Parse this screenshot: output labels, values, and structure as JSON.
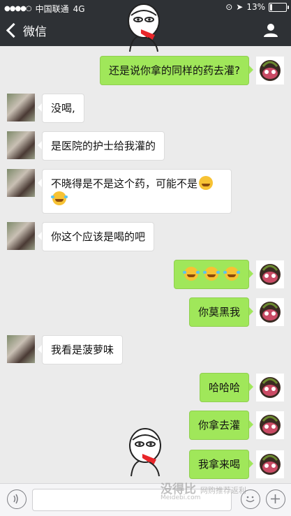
{
  "status_bar": {
    "carrier": "中国联通",
    "network": "4G",
    "battery": "13%",
    "battery_level": 0.13
  },
  "nav": {
    "back_label": "微信",
    "back_icon": "chevron-left-icon",
    "profile_icon": "person-icon"
  },
  "messages": [
    {
      "from": "me",
      "text": "还是说你拿的同样的药去灌?"
    },
    {
      "from": "other",
      "text": "没喝,"
    },
    {
      "from": "other",
      "text": "是医院的护士给我灌的"
    },
    {
      "from": "other",
      "text": "不晓得是不是这个药，可能不是"
    },
    {
      "from": "other",
      "text": "你这个应该是喝的吧"
    },
    {
      "from": "me",
      "emojis": [
        "tears-of-joy",
        "tears-of-joy",
        "tears-of-joy"
      ]
    },
    {
      "from": "me",
      "text": "你莫黑我"
    },
    {
      "from": "other",
      "text": "我看是菠萝味"
    },
    {
      "from": "me",
      "text": "哈哈哈"
    },
    {
      "from": "me",
      "text": "你拿去灌"
    },
    {
      "from": "me",
      "text": "我拿来喝"
    }
  ],
  "input_bar": {
    "voice_icon": "voice-icon",
    "emoji_icon": "emoji-icon",
    "add_icon": "plus-icon"
  },
  "watermark": {
    "title": "没得比",
    "subtitle": "Meidebi.com",
    "tagline": "网购推荐返利"
  },
  "colors": {
    "nav_background": "#2e3135",
    "chat_background": "#ebebeb",
    "my_bubble": "#a0e75a",
    "other_bubble": "#ffffff"
  }
}
